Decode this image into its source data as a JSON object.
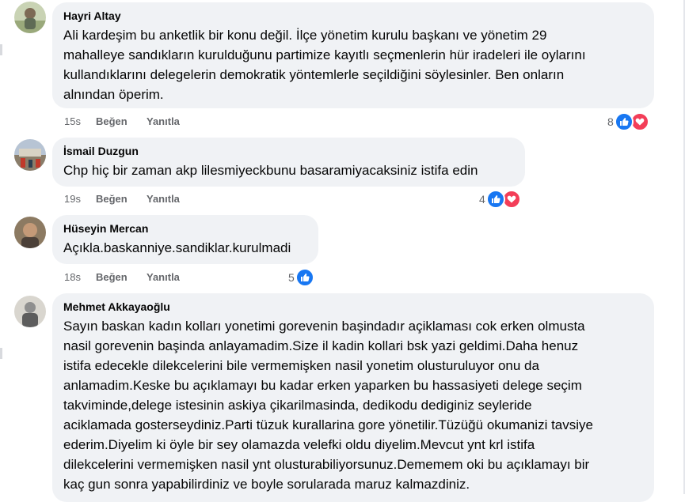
{
  "colors": {
    "accent_like": "#1877f2",
    "accent_love": "#f33e58",
    "bubble": "#f0f2f5",
    "muted": "#65676b"
  },
  "comments": [
    {
      "author": "Hayri Altay",
      "lines": [
        "Ali kardeşim bu anketlik bir konu değil. İlçe yönetim kurulu başkanı ve yönetim 29",
        "mahalleye sandıkların kurulduğunu partimize kayıtlı seçmenlerin hür iradeleri ile oylarını",
        "kullandıklarını delegelerin demokratik yöntemlerle seçildiğini söylesinler. Ben onların",
        "alnından öperim."
      ],
      "time": "15s",
      "like_label": "Beğen",
      "reply_label": "Yanıtla",
      "reaction_count": "8",
      "reactions": [
        "like-icon",
        "love-icon"
      ]
    },
    {
      "author": "İsmail Duzgun",
      "lines": [
        "Chp hiç bir zaman akp lilesmiyeckbunu basaramiyacaksiniz istifa edin"
      ],
      "time": "19s",
      "like_label": "Beğen",
      "reply_label": "Yanıtla",
      "reaction_count": "4",
      "reactions": [
        "like-icon",
        "love-icon"
      ]
    },
    {
      "author": "Hüseyin Mercan",
      "lines": [
        "Açıkla.baskanniye.sandiklar.kurulmadi"
      ],
      "time": "18s",
      "like_label": "Beğen",
      "reply_label": "Yanıtla",
      "reaction_count": "5",
      "reactions": [
        "like-icon"
      ]
    },
    {
      "author": "Mehmet Akkayaoğlu",
      "lines": [
        "Sayın baskan kadın kolları yonetimi gorevenin başindadır açiklaması cok erken olmusta",
        "nasil gorevenin başinda anlayamadim.Size il kadin kollari bsk yazi geldimi.Daha henuz",
        "istifa edecekle dilekcelerini bile vermemişken nasil yonetim olusturuluyor onu da",
        "anlamadim.Keske bu açıklamayı bu kadar erken yaparken bu hassasiyeti delege seçim",
        "takviminde,delege istesinin askiya çikarilmasinda, dedikodu dediginiz seyleride",
        "aciklamada gosterseydiniz.Parti tüzuk kurallarina gore yönetilir.Tüzüğü okumanizi tavsiye",
        "ederim.Diyelim ki öyle bir sey olamazda velefki oldu diyelim.Mevcut ynt krl istifa",
        "dilekcelerini vermemişken nasil ynt olusturabiliyorsunuz.Dememem oki bu açıklamayı bir",
        "kaç gun sonra yapabilirdiniz ve boyle sorularada maruz kalmazdiniz."
      ]
    }
  ]
}
